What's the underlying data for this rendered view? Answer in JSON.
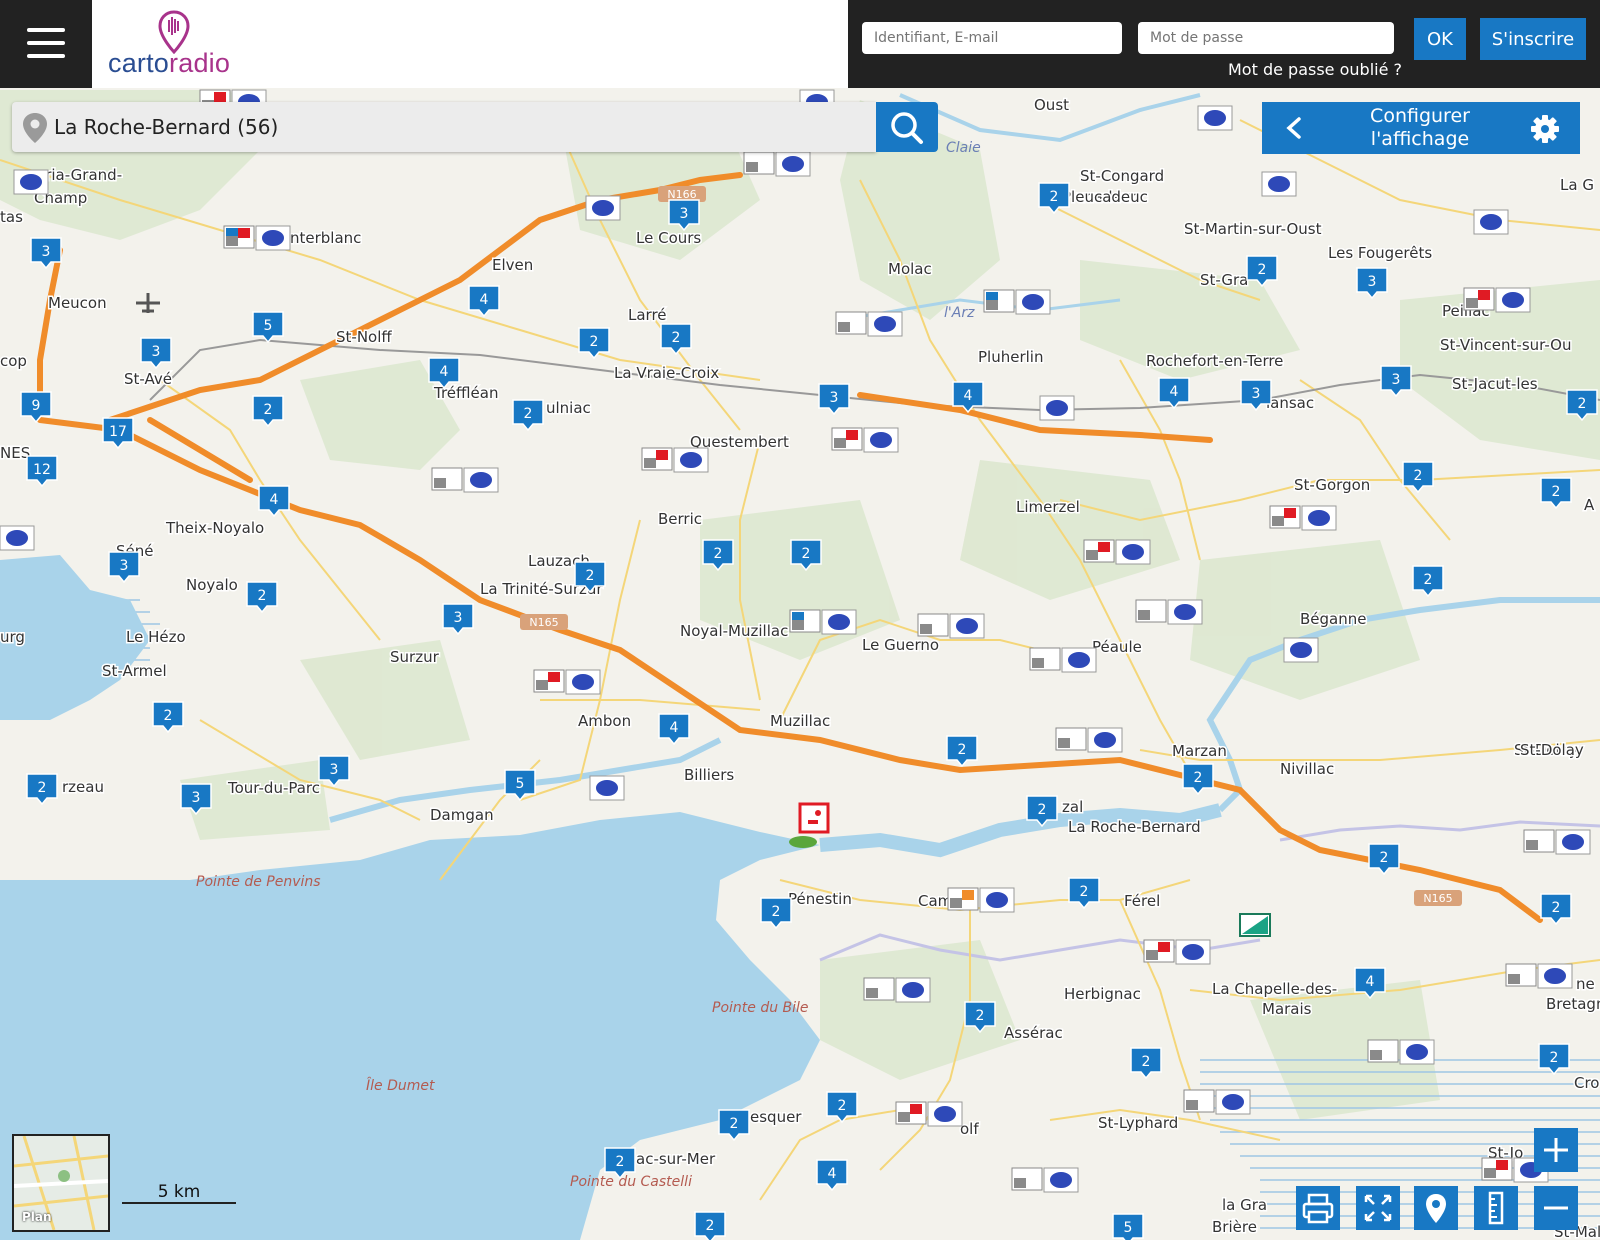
{
  "header": {
    "brand_part1": "carto",
    "brand_part2": "radio",
    "login_placeholder": "Identifiant, E-mail",
    "password_placeholder": "Mot de passe",
    "ok_label": "OK",
    "signup_label": "S'inscrire",
    "forgot_label": "Mot de passe oublié ?"
  },
  "search": {
    "value": "La Roche-Bernard (56)"
  },
  "config": {
    "line1": "Configurer",
    "line2": "l'affichage"
  },
  "map": {
    "scale_label": "5 km",
    "plan_label": "Plan",
    "towns": [
      "aria-Grand-",
      "Champ",
      "nterblanc",
      "Meucon",
      "St-Avé",
      "St-Nolff",
      "Elven",
      "Le Cours",
      "Larré",
      "La Vraie-Croix",
      "Molac",
      "Pluherlin",
      "Rochefort-en-Terre",
      "St-Congard",
      "ucadeuc",
      "St-Martin-sur-Oust",
      "Les Fougerêts",
      "St-Gra",
      "Oust",
      "Tréffléan",
      "ulniac",
      "Questembert",
      "Theix-Noyalo",
      "Séné",
      "Noyalo",
      "Lauzach",
      "La Trinité-Surzur",
      "Berric",
      "Limerzel",
      "St-Gorgon",
      "Noyal-Muzillac",
      "Le Guerno",
      "Péaule",
      "Béganne",
      "Le Hézo",
      "St-Armel",
      "Surzur",
      "Ambon",
      "Muzillac",
      "Billiers",
      "Marzan",
      "Nivillac",
      "St-Dolay",
      "rzeau",
      "Tour-du-Parc",
      "Damgan",
      "Pénestin",
      "Camoël",
      "Férel",
      "La Roche-Bernard",
      "zal",
      "Herbignac",
      "La Chapelle-des-",
      "Marais",
      "Assérac",
      "St-Lyphard",
      "esquer",
      "ac-sur-Mer",
      "olf",
      "Pleucadeuc",
      "lansac",
      "St-Vincent-sur-Ou",
      "St-Jacut-les",
      "Peillac",
      "La G",
      "ne",
      "Bretagn",
      "Cro",
      "St-Jo",
      "la Gra",
      "Brière",
      "tas",
      "cop",
      "NES",
      "urg",
      "St-Mal",
      "A",
      "St-Dolay"
    ],
    "places": [
      "Pointe de Penvins",
      "Pointe du Bile",
      "Île Dumet",
      "Pointe du Castelli",
      "Claie",
      "l'Arz"
    ],
    "roads": [
      "N166",
      "N165",
      "N165"
    ],
    "markers": [
      "3",
      "4",
      "5",
      "3",
      "2",
      "9",
      "17",
      "12",
      "4",
      "3",
      "3",
      "2",
      "4",
      "2",
      "2",
      "3",
      "2",
      "2",
      "2",
      "3",
      "4",
      "4",
      "3",
      "3",
      "2",
      "2",
      "2",
      "2",
      "2",
      "3",
      "2",
      "4",
      "2",
      "2",
      "3",
      "3",
      "5",
      "2",
      "2",
      "2",
      "2",
      "2",
      "2",
      "2",
      "4",
      "2",
      "2",
      "2",
      "4",
      "2",
      "2",
      "5",
      "2",
      "2",
      "2"
    ]
  },
  "toolbar": {
    "print": "print-icon",
    "fullscreen": "fullscreen-icon",
    "locate": "location-icon",
    "measure": "ruler-icon",
    "zoom_in": "plus-icon",
    "zoom_out": "minus-icon"
  },
  "colors": {
    "accent": "#1878c4",
    "brand_blue": "#2a4d92",
    "brand_pink": "#a8338b",
    "motorway": "#f08c2a",
    "water": "#a9d3ea"
  }
}
